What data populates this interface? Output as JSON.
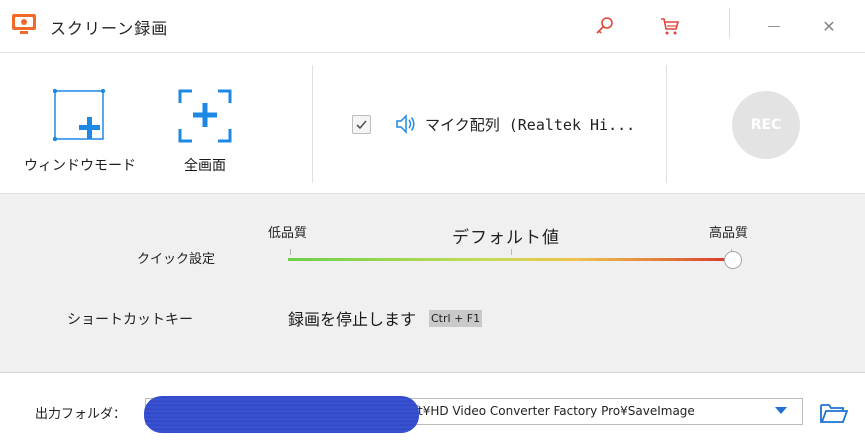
{
  "window": {
    "title": "スクリーン録画",
    "icons": {
      "app": "screen-record-app-icon",
      "key": "key-icon",
      "cart": "cart-icon",
      "minimize": "minimize-icon",
      "close": "close-icon"
    },
    "minimize_glyph": "—",
    "close_glyph": "✕"
  },
  "modes": {
    "window_mode": {
      "label": "ウィンドウモード",
      "icon": "window-capture-icon"
    },
    "fullscreen": {
      "label": "全画面",
      "icon": "fullscreen-capture-icon"
    }
  },
  "audio": {
    "checked": true,
    "label": "マイク配列 (Realtek Hi...",
    "icon": "speaker-icon"
  },
  "rec_button": {
    "label": "REC"
  },
  "quality": {
    "label": "クイック設定",
    "low": "低品質",
    "default": "デフォルト値",
    "high": "高品質",
    "value": 1.0
  },
  "hotkey": {
    "label": "ショートカットキー",
    "action": "録画を停止します",
    "keys": "Ctrl + F1"
  },
  "output": {
    "label": "出力フォルダ：",
    "path_visible": "ft¥HD Video Converter Factory Pro¥SaveImage",
    "icon": "folder-open-icon"
  },
  "colors": {
    "accent_blue": "#1e88e5",
    "icon_red": "#e0473a",
    "rec_disabled": "#e3e3e3"
  }
}
